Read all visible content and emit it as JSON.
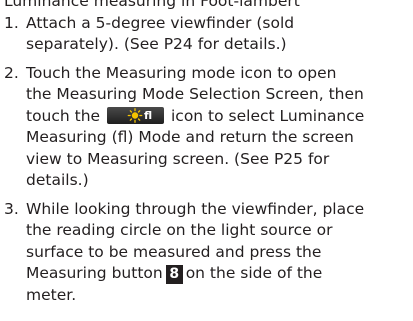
{
  "heading": "Luminance measuring in Foot-lambert",
  "steps": [
    {
      "number": "1.",
      "lines": [
        "Attach a 5-degree viewfinder (sold",
        "separately). (See P24 for details.)"
      ]
    },
    {
      "number": "2.",
      "line1": "Touch the Measuring mode icon to open",
      "line2": "the Measuring Mode Selection Screen, then",
      "line3_before": "touch the",
      "line3_after": "icon to select Luminance",
      "icon_label": "fl",
      "icon_name": "luminance-fl-icon",
      "line4": "Measuring (fl) Mode and return the screen",
      "line5": "view to Measuring screen. (See P25 for",
      "line6": "details.)"
    },
    {
      "number": "3.",
      "line1": "While looking through the viewfinder, place",
      "line2": "the reading circle on the light source or",
      "line3": "surface to be measured and press the",
      "line4_before": "Measuring button",
      "badge": "8",
      "line4_after": "on the side of the",
      "line5": "meter."
    }
  ],
  "colors": {
    "text": "#231f20",
    "icon_bg": "#2b2b2b",
    "sun": "#f5c400",
    "badge_bg": "#231f20"
  }
}
